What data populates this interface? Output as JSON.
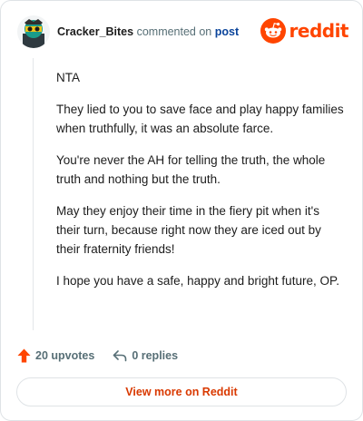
{
  "comment": {
    "author": "Cracker_Bites",
    "action_text": "commented on",
    "post_link_label": "post",
    "paragraphs": [
      "NTA",
      "They lied to you to save face and play happy families when truthfully, it was an absolute farce.",
      "You're never the AH for telling the truth, the whole truth and nothing but the truth.",
      "May they enjoy their time in the fiery pit when it's their turn, because right now they are iced out by their fraternity friends!",
      "I hope you have a safe, happy and bright future, OP."
    ]
  },
  "brand": {
    "wordmark": "reddit",
    "icon": "reddit-snoo-icon",
    "color": "#ff4500"
  },
  "footer": {
    "upvotes_label": "20 upvotes",
    "upvote_icon": "upvote-arrow-icon",
    "upvote_color": "#ff4500",
    "replies_label": "0 replies",
    "reply_icon": "reply-arrow-icon"
  },
  "cta": {
    "view_more_label": "View more on Reddit",
    "color": "#d93900"
  }
}
